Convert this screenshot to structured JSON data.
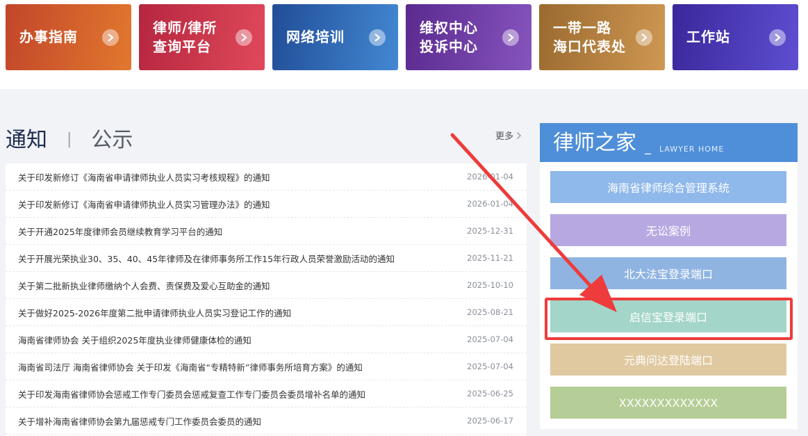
{
  "tiles": [
    {
      "label": "办事指南",
      "color_from": "#c2462a",
      "color_to": "#e1782e"
    },
    {
      "label": "律师/律所\n查询平台",
      "color_from": "#b5263f",
      "color_to": "#e0495a"
    },
    {
      "label": "网络培训",
      "color_from": "#214d97",
      "color_to": "#4388d3"
    },
    {
      "label": "维权中心\n投诉中心",
      "color_from": "#5a2a8f",
      "color_to": "#8654bd"
    },
    {
      "label": "一带一路\n海口代表处",
      "color_from": "#9a6a2f",
      "color_to": "#cf9752"
    },
    {
      "label": "工作站",
      "color_from": "#3a279b",
      "color_to": "#5d4fd1"
    }
  ],
  "notices": {
    "title": "通知",
    "separator": "|",
    "subtitle": "公示",
    "more": "更多",
    "items": [
      {
        "title": "关于印发新修订《海南省申请律师执业人员实习考核规程》的通知",
        "date": "2026-01-04"
      },
      {
        "title": "关于印发新修订《海南省申请律师执业人员实习管理办法》的通知",
        "date": "2026-01-04"
      },
      {
        "title": "关于开通2025年度律师会员继续教育学习平台的通知",
        "date": "2025-12-31"
      },
      {
        "title": "关于开展光荣执业30、35、40、45年律师及在律师事务所工作15年行政人员荣誉激励活动的通知",
        "date": "2025-11-21"
      },
      {
        "title": "关于第二批新执业律师缴纳个人会费、责保费及爱心互助金的通知",
        "date": "2025-10-10"
      },
      {
        "title": "关于做好2025-2026年度第二批申请律师执业人员实习登记工作的通知",
        "date": "2025-08-21"
      },
      {
        "title": "海南省律师协会 关于组织2025年度执业律师健康体检的通知",
        "date": "2025-07-04"
      },
      {
        "title": "海南省司法厅 海南省律师协会 关于印发《海南省“专精特新”律师事务所培育方案》的通知",
        "date": "2025-07-04"
      },
      {
        "title": "关于印发海南省律师协会惩戒工作专门委员会惩戒复查工作专门委员会委员增补名单的通知",
        "date": "2025-06-25"
      },
      {
        "title": "关于增补海南省律师协会第九届惩戒专门工作委员会委员的通知",
        "date": "2025-06-17"
      }
    ]
  },
  "lawyer_home": {
    "title": "律师之家",
    "underscore": "_",
    "subtitle_en": "LAWYER HOME",
    "buttons": [
      {
        "label": "海南省律师综合管理系统",
        "color": "#8fb8eb"
      },
      {
        "label": "无讼案例",
        "color": "#b8a8e2"
      },
      {
        "label": "北大法宝登录端口",
        "color": "#8fb4e2"
      },
      {
        "label": "启信宝登录端口",
        "color": "#a3d5c8"
      },
      {
        "label": "元典问达登陆端口",
        "color": "#e0c9a0"
      },
      {
        "label": "XXXXXXXXXXXXX",
        "color": "#b5cd96"
      }
    ]
  },
  "colors": {
    "annotation": "#ee3b3b",
    "header_blue": "#4f8fd9"
  }
}
